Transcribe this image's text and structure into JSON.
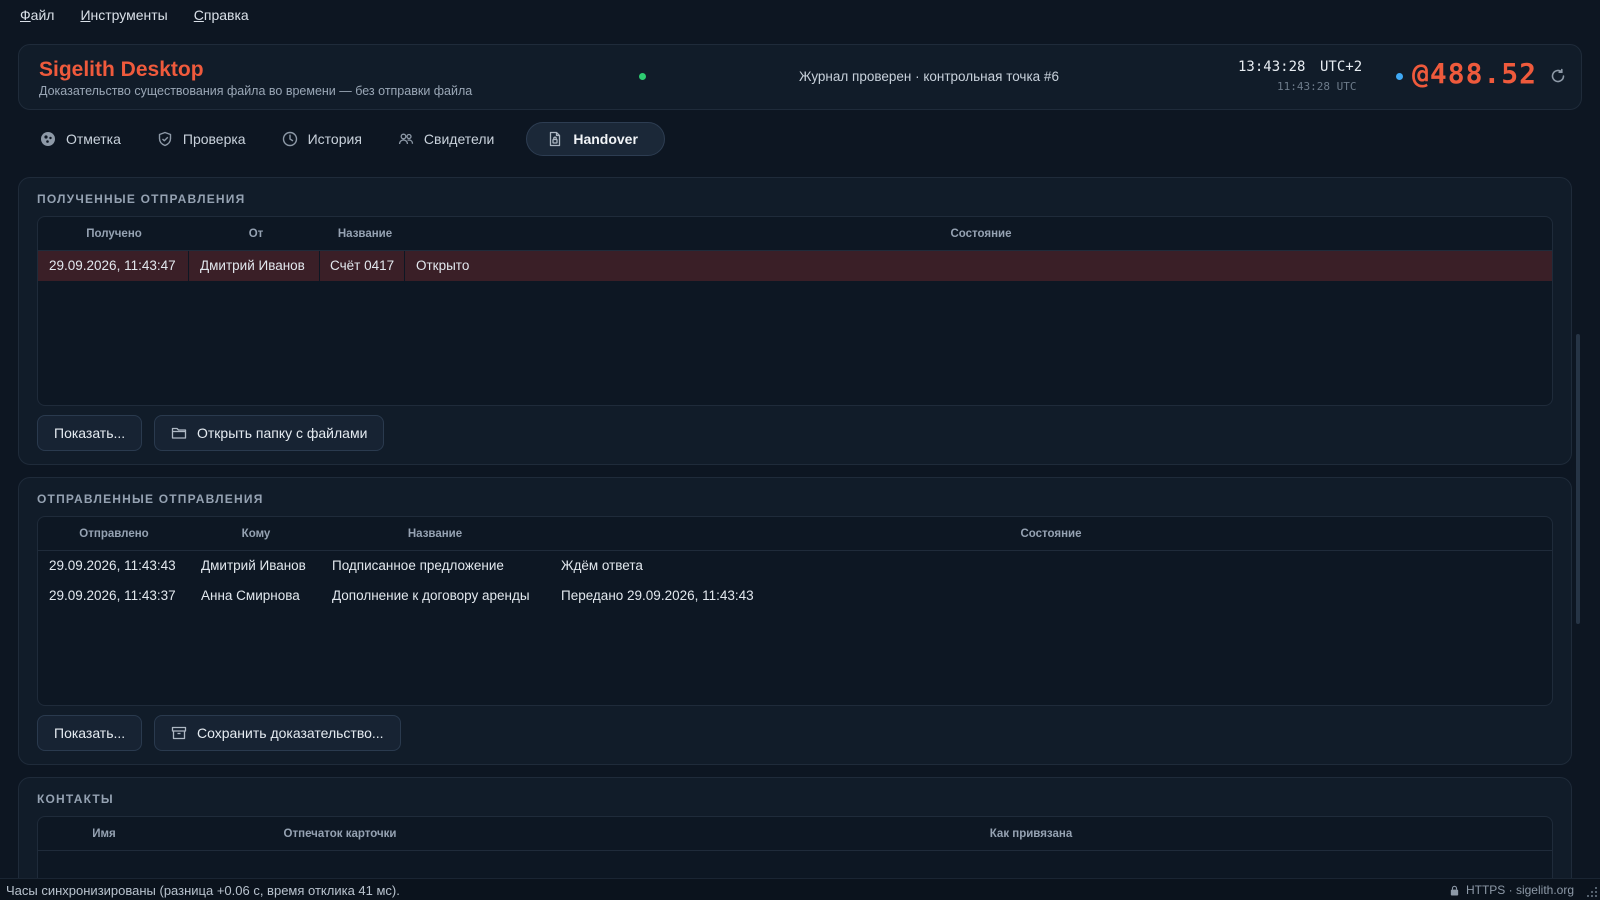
{
  "menu": [
    {
      "accel": "Ф",
      "rest": "айл"
    },
    {
      "accel": "И",
      "rest": "нструменты"
    },
    {
      "accel": "С",
      "rest": "правка"
    }
  ],
  "header": {
    "title": "Sigelith Desktop",
    "subtitle": "Доказательство существования файла во времени — без отправки файла",
    "journal": "Журнал проверен · контрольная точка #6",
    "time": "13:43:28",
    "tz": "UTC+2",
    "utc_time": "11:43:28 UTC",
    "counter": "@488.52",
    "accent": "#ef5a3c"
  },
  "tabs": [
    {
      "label": "Отметка",
      "icon": "stamp-icon"
    },
    {
      "label": "Проверка",
      "icon": "shield-check-icon"
    },
    {
      "label": "История",
      "icon": "clock-icon"
    },
    {
      "label": "Свидетели",
      "icon": "people-icon"
    },
    {
      "label": "Handover",
      "icon": "document-lock-icon",
      "active": true
    }
  ],
  "received": {
    "title": "ПОЛУЧЕННЫЕ ОТПРАВЛЕНИЯ",
    "columns": [
      "Получено",
      "От",
      "Название",
      "Состояние"
    ],
    "rows": [
      [
        "29.09.2026, 11:43:47",
        "Дмитрий Иванов",
        "Счёт 0417",
        "Открыто"
      ]
    ],
    "show_button": "Показать...",
    "folder_button": "Открыть папку с файлами"
  },
  "sent": {
    "title": "ОТПРАВЛЕННЫЕ ОТПРАВЛЕНИЯ",
    "columns": [
      "Отправлено",
      "Кому",
      "Название",
      "Состояние"
    ],
    "rows": [
      [
        "29.09.2026, 11:43:43",
        "Дмитрий Иванов",
        "Подписанное предложение",
        "Ждём ответа"
      ],
      [
        "29.09.2026, 11:43:37",
        "Анна Смирнова",
        "Дополнение к договору аренды",
        "Передано 29.09.2026, 11:43:43"
      ]
    ],
    "show_button": "Показать...",
    "save_button": "Сохранить доказательство..."
  },
  "contacts": {
    "title": "КОНТАКТЫ",
    "columns": [
      "Имя",
      "Отпечаток карточки",
      "Как привязана"
    ]
  },
  "statusbar": {
    "text": "Часы синхронизированы (разница +0.06 с, время отклика 41 мс).",
    "right": "HTTPS · sigelith.org"
  }
}
